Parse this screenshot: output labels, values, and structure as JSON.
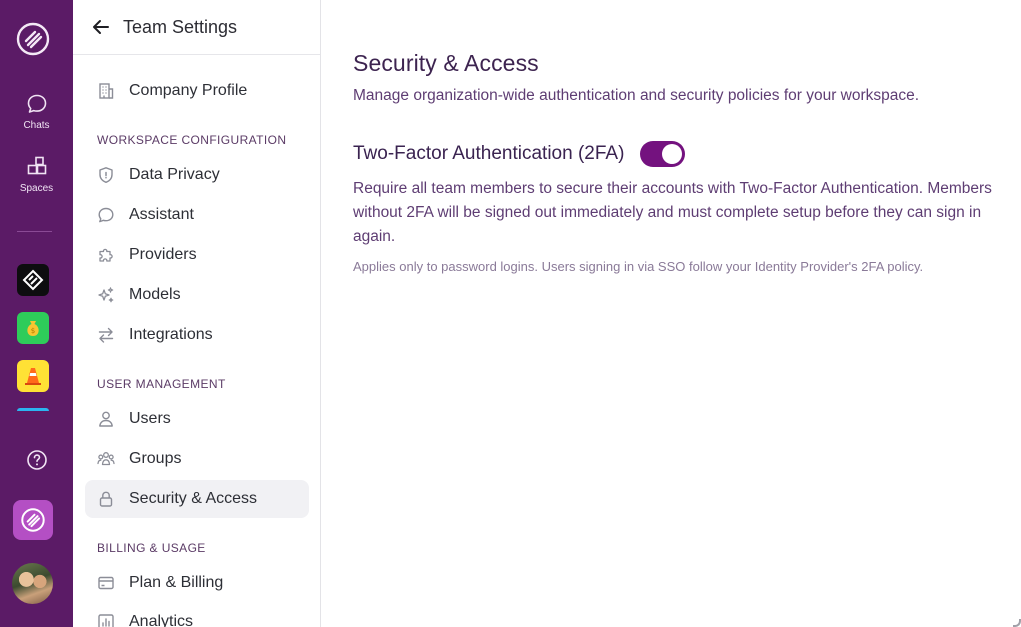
{
  "rail": {
    "chats_label": "Chats",
    "spaces_label": "Spaces",
    "accent": "#5b1b66"
  },
  "sidebar": {
    "title": "Team Settings",
    "top_item": {
      "label": "Company Profile",
      "icon": "building-icon"
    },
    "sections": [
      {
        "label": "WORKSPACE CONFIGURATION",
        "items": [
          {
            "label": "Data Privacy",
            "icon": "shield-icon"
          },
          {
            "label": "Assistant",
            "icon": "chat-bubble-icon"
          },
          {
            "label": "Providers",
            "icon": "puzzle-icon"
          },
          {
            "label": "Models",
            "icon": "sparkles-icon"
          },
          {
            "label": "Integrations",
            "icon": "arrows-exchange-icon"
          }
        ]
      },
      {
        "label": "USER MANAGEMENT",
        "items": [
          {
            "label": "Users",
            "icon": "user-icon"
          },
          {
            "label": "Groups",
            "icon": "group-icon"
          },
          {
            "label": "Security & Access",
            "icon": "lock-icon",
            "active": true
          }
        ]
      },
      {
        "label": "BILLING & USAGE",
        "items": [
          {
            "label": "Plan & Billing",
            "icon": "credit-card-icon"
          },
          {
            "label": "Analytics",
            "icon": "bar-chart-icon"
          }
        ]
      }
    ]
  },
  "main": {
    "title": "Security & Access",
    "subtitle": "Manage organization-wide authentication and security policies for your workspace.",
    "setting": {
      "name": "Two-Factor Authentication (2FA)",
      "enabled": true,
      "description": "Require all team members to secure their accounts with Two-Factor Authentication. Members without 2FA will be signed out immediately and must complete setup before they can sign in again.",
      "note": "Applies only to password logins. Users signing in via SSO follow your Identity Provider's 2FA policy."
    }
  },
  "colors": {
    "toggle_on": "#74127f",
    "active_nav_bg": "#f1f1f4",
    "workspace_tile": "#b44fc4"
  }
}
